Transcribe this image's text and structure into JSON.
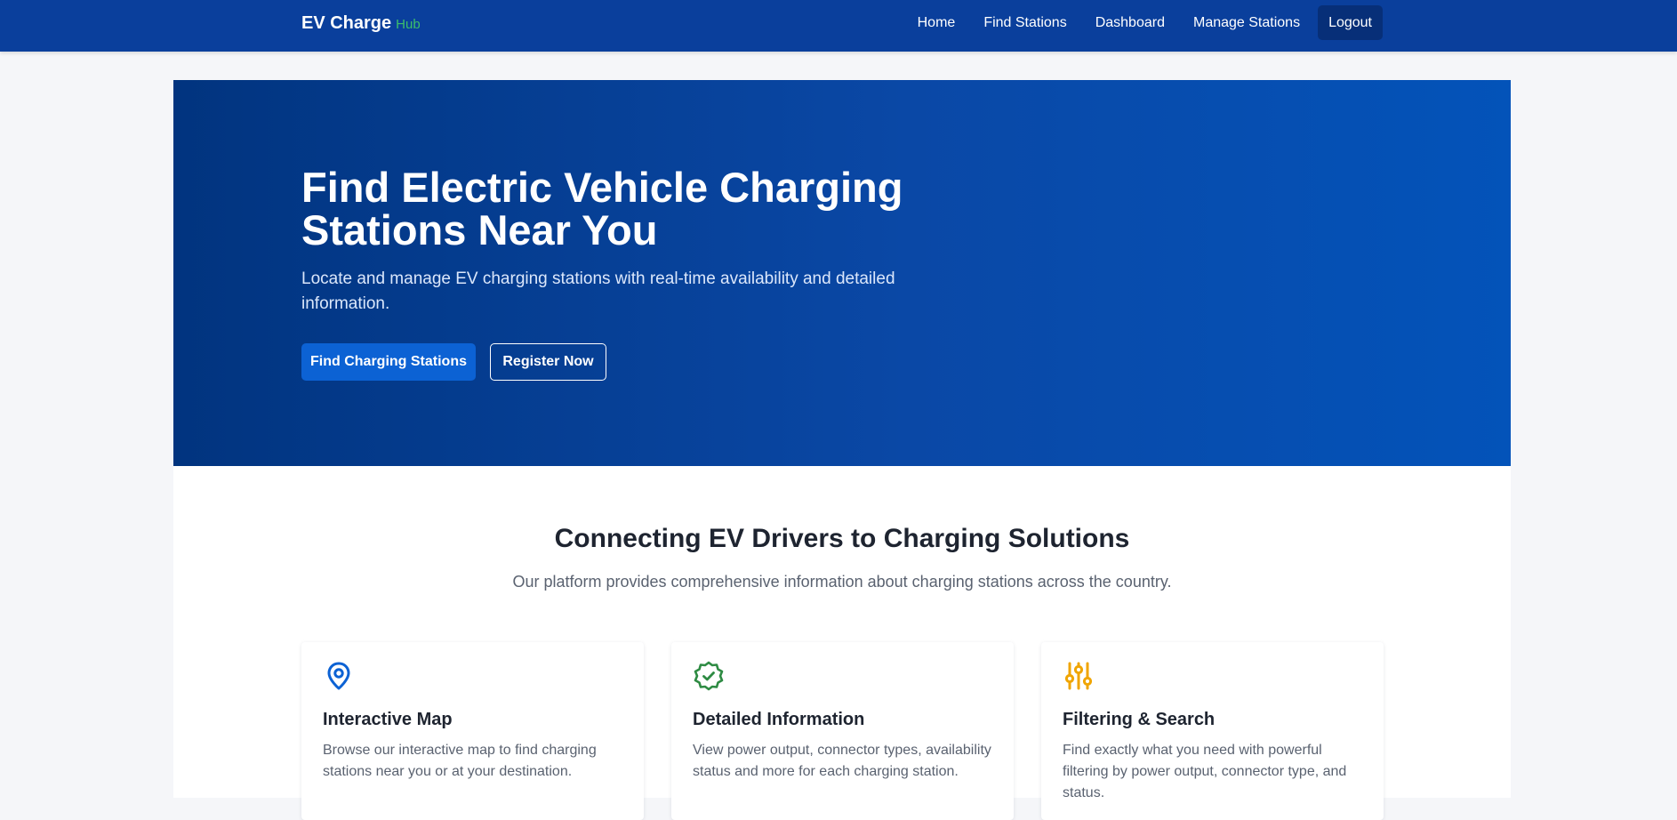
{
  "brand": {
    "main": "EV Charge",
    "sub": "Hub",
    "sub_color": "#3cbf6b"
  },
  "nav": {
    "items": [
      {
        "label": "Home"
      },
      {
        "label": "Find Stations"
      },
      {
        "label": "Dashboard"
      },
      {
        "label": "Manage Stations"
      },
      {
        "label": "Logout"
      }
    ]
  },
  "hero": {
    "title": "Find Electric Vehicle Charging Stations Near You",
    "subtitle": "Locate and manage EV charging stations with real-time availability and detailed information.",
    "primary_button": "Find Charging Stations",
    "secondary_button": "Register Now"
  },
  "features": {
    "title": "Connecting EV Drivers to Charging Solutions",
    "subtitle": "Our platform provides comprehensive information about charging stations across the country.",
    "cards": [
      {
        "icon": "map-pin-icon",
        "icon_color": "#0c62d4",
        "title": "Interactive Map",
        "text": "Browse our interactive map to find charging stations near you or at your destination."
      },
      {
        "icon": "verified-badge-icon",
        "icon_color": "#2e8b43",
        "title": "Detailed Information",
        "text": "View power output, connector types, availability status and more for each charging station."
      },
      {
        "icon": "sliders-icon",
        "icon_color": "#f0a500",
        "title": "Filtering & Search",
        "text": "Find exactly what you need with powerful filtering by power output, connector type, and status."
      }
    ]
  },
  "colors": {
    "navbar": "#0a3f9c",
    "hero_dark": "#01347f",
    "hero_light": "#0353b9",
    "primary_button": "#0c62d4"
  }
}
